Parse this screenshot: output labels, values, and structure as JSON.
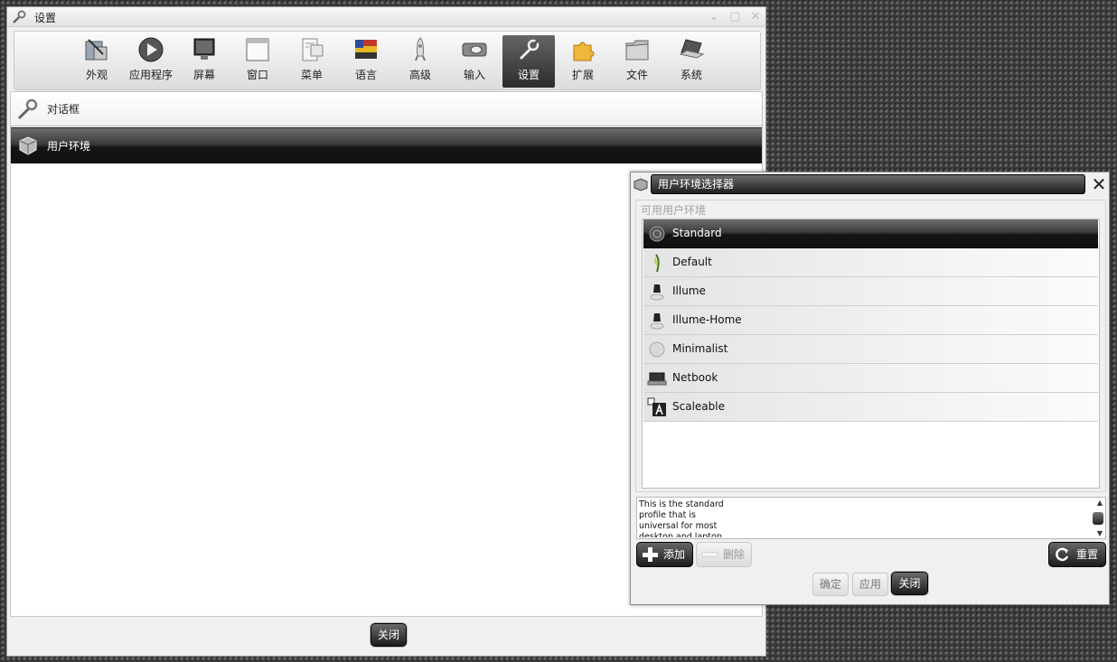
{
  "main_window": {
    "title": "设置",
    "toolbar": [
      {
        "label": "外观",
        "icon": "appearance-icon"
      },
      {
        "label": "应用程序",
        "icon": "play-icon"
      },
      {
        "label": "屏幕",
        "icon": "monitor-icon"
      },
      {
        "label": "窗口",
        "icon": "window-icon"
      },
      {
        "label": "菜单",
        "icon": "menu-icon"
      },
      {
        "label": "语言",
        "icon": "flag-icon"
      },
      {
        "label": "高级",
        "icon": "rocket-icon"
      },
      {
        "label": "输入",
        "icon": "mouse-icon"
      },
      {
        "label": "设置",
        "icon": "wrench-icon",
        "active": true
      },
      {
        "label": "扩展",
        "icon": "puzzle-icon"
      },
      {
        "label": "文件",
        "icon": "folder-icon"
      },
      {
        "label": "系统",
        "icon": "laptop-icon"
      }
    ],
    "categories": [
      {
        "label": "对话框",
        "icon": "wrench-icon"
      },
      {
        "label": "用户环境",
        "icon": "cube-icon",
        "selected": true
      }
    ],
    "close_label": "关闭"
  },
  "dialog": {
    "title": "用户环境选择器",
    "frame_label": "可用用户环境",
    "profiles": [
      {
        "label": "Standard",
        "icon": "standard-icon",
        "selected": true
      },
      {
        "label": "Default",
        "icon": "leaf-icon"
      },
      {
        "label": "Illume",
        "icon": "lamp-icon"
      },
      {
        "label": "Illume-Home",
        "icon": "lamp-icon"
      },
      {
        "label": "Minimalist",
        "icon": "sphere-icon"
      },
      {
        "label": "Netbook",
        "icon": "netbook-icon"
      },
      {
        "label": "Scaleable",
        "icon": "scale-text-icon"
      }
    ],
    "description": "This is the standard\nprofile that is\nuniversal for most\ndesktop and laptop",
    "add_label": "添加",
    "delete_label": "删除",
    "reset_label": "重置",
    "ok_label": "确定",
    "apply_label": "应用",
    "close_label": "关闭"
  },
  "colors": {
    "selection_dark": "#1a1a1a",
    "window_bg": "#f0f0f0",
    "disabled_text": "#9a9a9a"
  }
}
